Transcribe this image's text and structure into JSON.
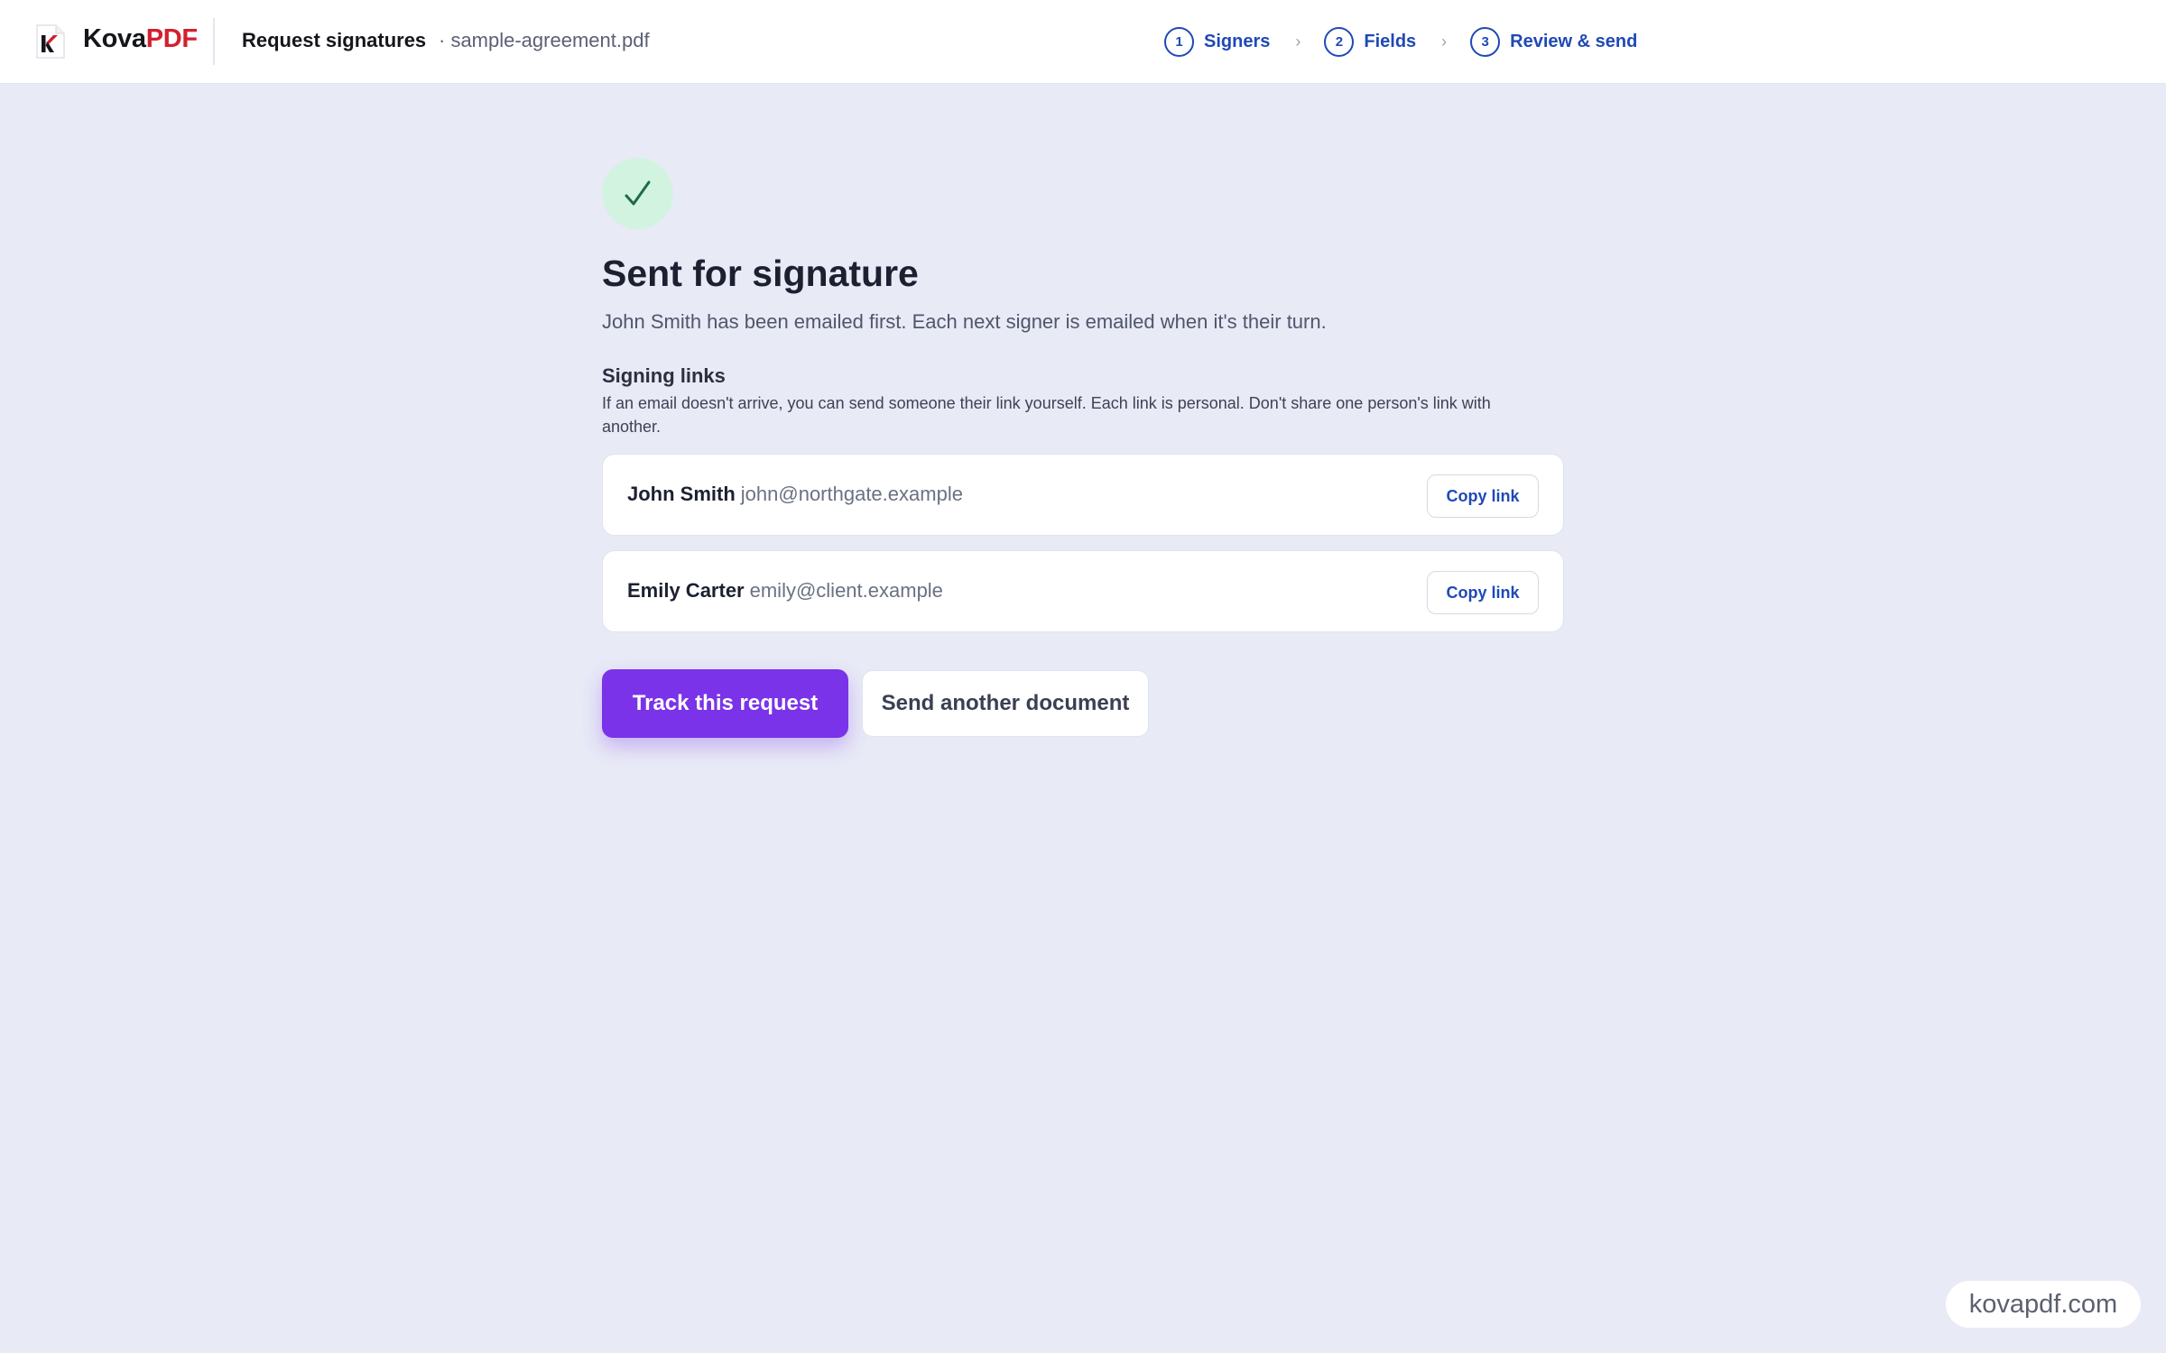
{
  "header": {
    "brand_part1": "Kova",
    "brand_part2": "PDF",
    "page_title": "Request signatures",
    "file_name": "· sample-agreement.pdf"
  },
  "steps": [
    {
      "number": "1",
      "label": "Signers"
    },
    {
      "number": "2",
      "label": "Fields"
    },
    {
      "number": "3",
      "label": "Review & send"
    }
  ],
  "step_separator": "›",
  "main": {
    "success_icon": "checkmark-icon",
    "headline": "Sent for signature",
    "subtext": "John Smith has been emailed first. Each next signer is emailed when it's their turn.",
    "links_title": "Signing links",
    "links_help": "If an email doesn't arrive, you can send someone their link yourself. Each link is personal. Don't share one person's link with another."
  },
  "signers": [
    {
      "name": "John Smith",
      "email": "john@northgate.example",
      "action": "Copy link"
    },
    {
      "name": "Emily Carter",
      "email": "emily@client.example",
      "action": "Copy link"
    }
  ],
  "actions": {
    "primary": "Track this request",
    "secondary": "Send another document"
  },
  "watermark": "kovapdf.com",
  "colors": {
    "accent": "#7a33e8",
    "link_blue": "#1f49b6",
    "brand_red": "#d3202e",
    "success_bg": "#d3f3e1",
    "success_check": "#1e6b46",
    "page_bg": "#e8eaf6"
  }
}
